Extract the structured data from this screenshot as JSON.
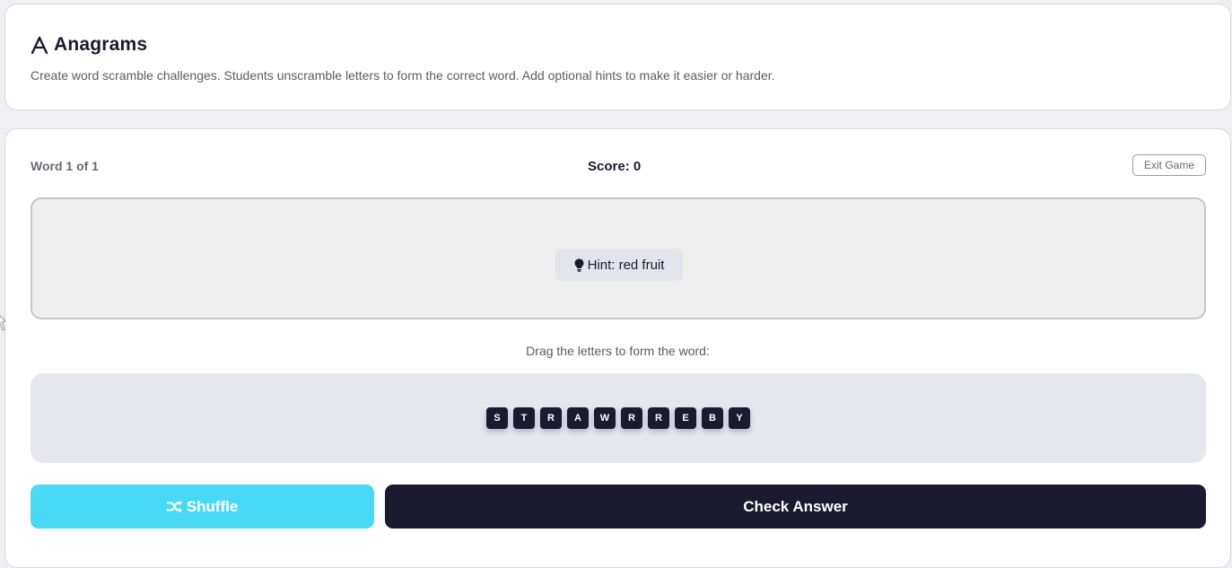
{
  "header": {
    "icon": "font-a-icon",
    "title": "Anagrams",
    "description": "Create word scramble challenges. Students unscramble letters to form the correct word. Add optional hints to make it easier or harder."
  },
  "game": {
    "word_counter": "Word 1 of 1",
    "score": "Score: 0",
    "exit_label": "Exit Game",
    "hint": {
      "icon": "lightbulb-icon",
      "text": "Hint: red fruit"
    },
    "instruction": "Drag the letters to form the word:",
    "letters": [
      "S",
      "T",
      "R",
      "A",
      "W",
      "R",
      "R",
      "E",
      "B",
      "Y"
    ],
    "shuffle_label": "Shuffle",
    "shuffle_icon": "shuffle-icon",
    "check_label": "Check Answer"
  },
  "colors": {
    "primary_dark": "#1b1a2e",
    "accent_cyan": "#48d9f6",
    "page_bg": "#f0eff4",
    "hint_bg": "#e4e4ed",
    "letters_bg": "#e6e6ef"
  }
}
